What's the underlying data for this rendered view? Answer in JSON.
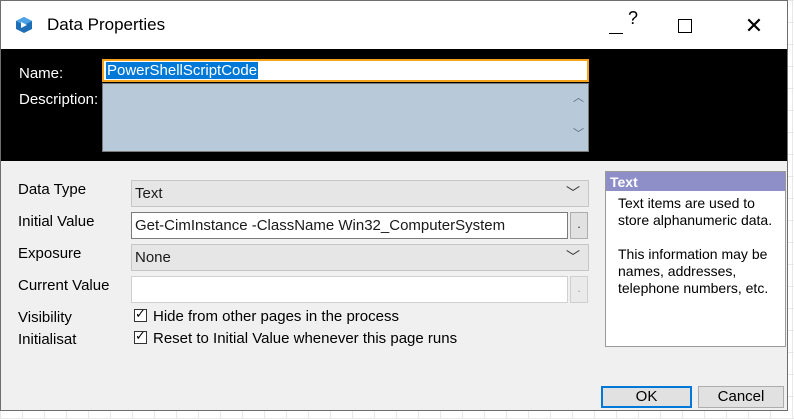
{
  "window": {
    "title": "Data Properties",
    "help_glyph": "?",
    "close_glyph": "✕",
    "icon": "blueprism-app-icon"
  },
  "header": {
    "name_label": "Name:",
    "name_value": "PowerShellScriptCode",
    "description_label": "Description:",
    "description_value": ""
  },
  "form": {
    "data_type_label": "Data Type",
    "data_type_value": "Text",
    "initial_value_label": "Initial Value",
    "initial_value": "Get-CimInstance -ClassName Win32_ComputerSystem",
    "exposure_label": "Exposure",
    "exposure_value": "None",
    "current_value_label": "Current Value",
    "current_value": "",
    "visibility_label": "Visibility",
    "initialisat_label": "Initialisat",
    "hide_checkbox_label": "Hide from other pages in the process",
    "hide_checked": true,
    "reset_checkbox_label": "Reset to Initial Value whenever this page runs",
    "reset_checked": true,
    "ellipsis": "."
  },
  "help": {
    "title": "Text",
    "para1": "Text items are used to store alphanumeric data.",
    "para2": "This information may be names, addresses, telephone numbers, etc."
  },
  "buttons": {
    "ok_label": "OK",
    "cancel_label": "Cancel"
  },
  "colors": {
    "header_band": "#000000",
    "name_focus_border": "#f4a21c",
    "selection": "#0078d7",
    "description_bg": "#b8cad9",
    "help_title_bg": "#8e8ec8"
  }
}
